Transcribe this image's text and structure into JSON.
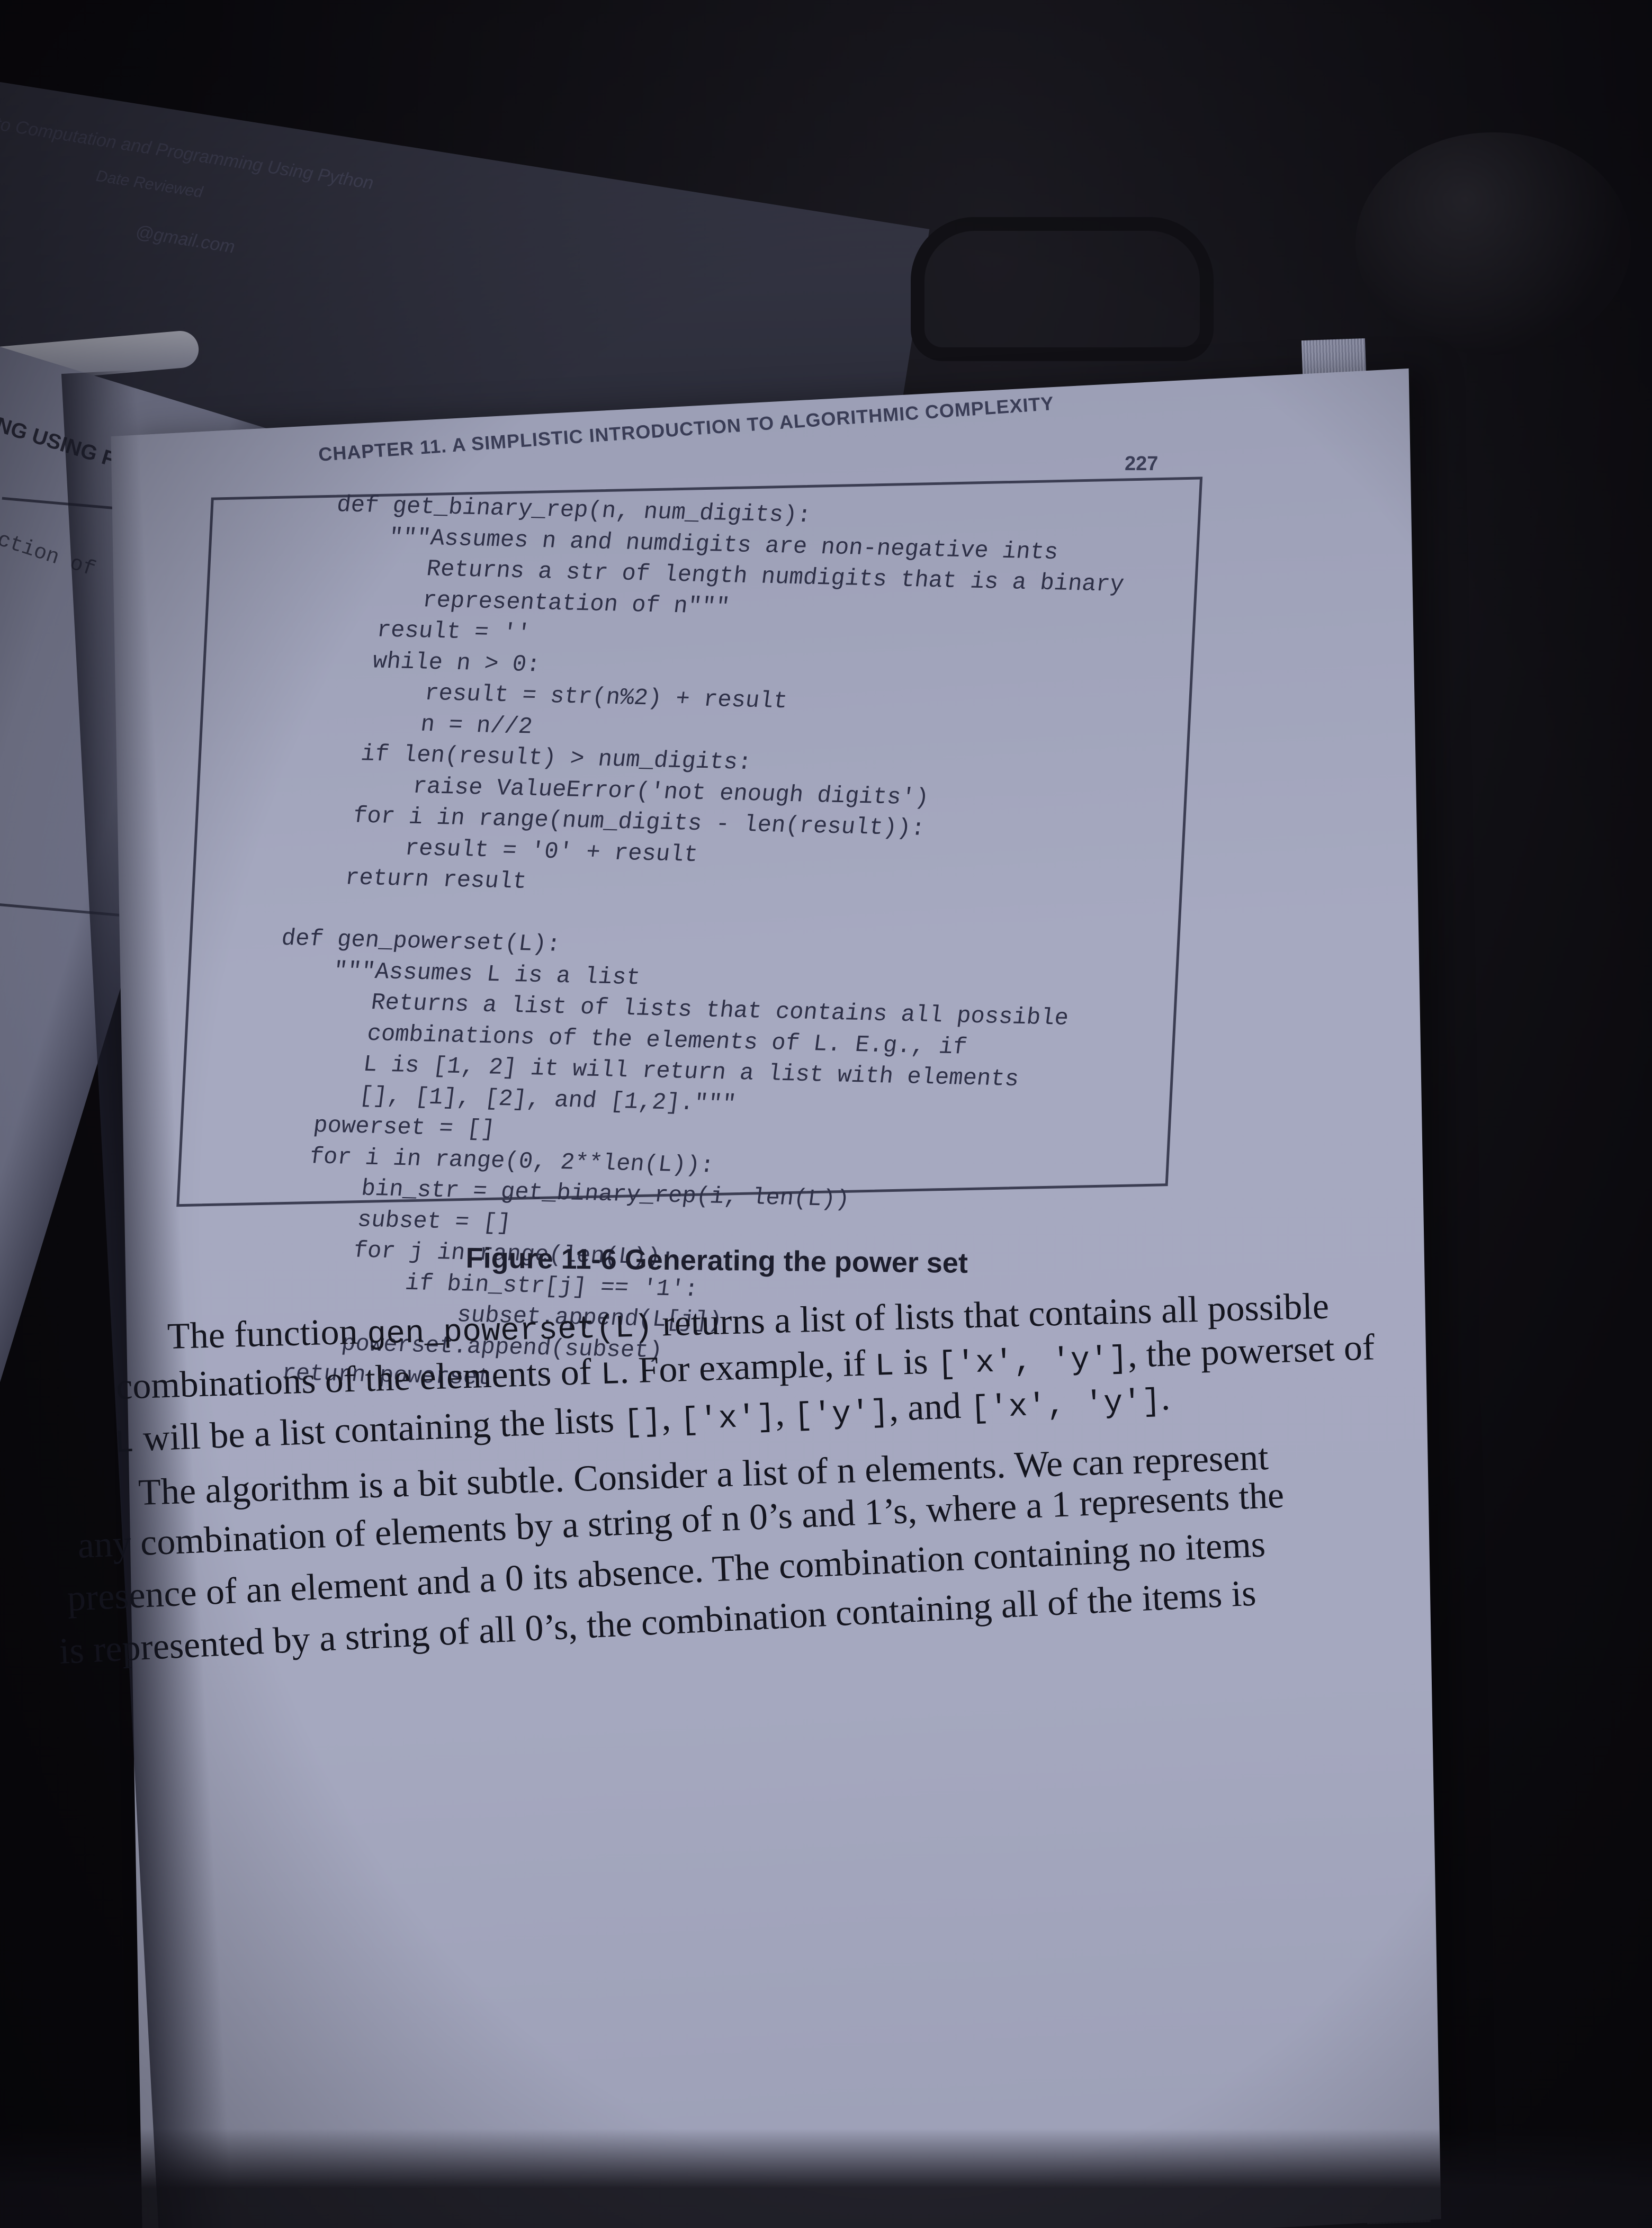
{
  "background_sheet": {
    "line_1": "Introduction to Computation and Programming Using Python",
    "line_2": "Date      Reviewed",
    "line_3": "@gmail.com"
  },
  "left_page": {
    "running_head": "NG USING PYTHON",
    "code_fragment": "ection of"
  },
  "page": {
    "running_head": "CHAPTER 11. A SIMPLISTIC INTRODUCTION TO ALGORITHMIC COMPLEXITY",
    "page_number": "227"
  },
  "figure": {
    "code": "def get_binary_rep(n, num_digits):\n    \"\"\"Assumes n and numdigits are non-negative ints\n       Returns a str of length numdigits that is a binary\n       representation of n\"\"\"\n    result = ''\n    while n > 0:\n        result = str(n%2) + result\n        n = n//2\n    if len(result) > num_digits:\n        raise ValueError('not enough digits')\n    for i in range(num_digits - len(result)):\n        result = '0' + result\n    return result\n\ndef gen_powerset(L):\n    \"\"\"Assumes L is a list\n       Returns a list of lists that contains all possible\n       combinations of the elements of L. E.g., if\n       L is [1, 2] it will return a list with elements\n       [], [1], [2], and [1,2].\"\"\"\n    powerset = []\n    for i in range(0, 2**len(L)):\n        bin_str = get_binary_rep(i, len(L))\n        subset = []\n        for j in range(len(L)):\n            if bin_str[j] == '1':\n                subset.append(L[j])\n        powerset.append(subset)\n    return powerset",
    "caption": "Figure 11-6 Generating the power set"
  },
  "body": {
    "line_1_a": "The function ",
    "line_1_code": "gen_powerset(L)",
    "line_1_b": " returns a list of lists that contains all possible",
    "line_2_a": "combinations of the elements of ",
    "line_2_code_1": "L",
    "line_2_b": ". For example, if ",
    "line_2_code_2": "L",
    "line_2_c": " is ",
    "line_2_code_3": "['x', 'y']",
    "line_2_d": ", the powerset of",
    "line_3_code_1": "L",
    "line_3_a": " will be a list containing the lists ",
    "line_3_code_2": "[]",
    "line_3_b": ", ",
    "line_3_code_3": "['x']",
    "line_3_c": ", ",
    "line_3_code_4": "['y']",
    "line_3_d": ", and ",
    "line_3_code_5": "['x', 'y']",
    "line_3_e": ".",
    "line_4": "The algorithm is a bit subtle. Consider a list of n elements. We can represent",
    "line_5": "any combination of elements by a string of n 0’s and 1’s, where a 1 represents the",
    "line_6": "presence of an element and a 0 its absence. The combination containing no items",
    "line_7": "is represented by a string of all 0’s, the combination containing all of the items is"
  }
}
